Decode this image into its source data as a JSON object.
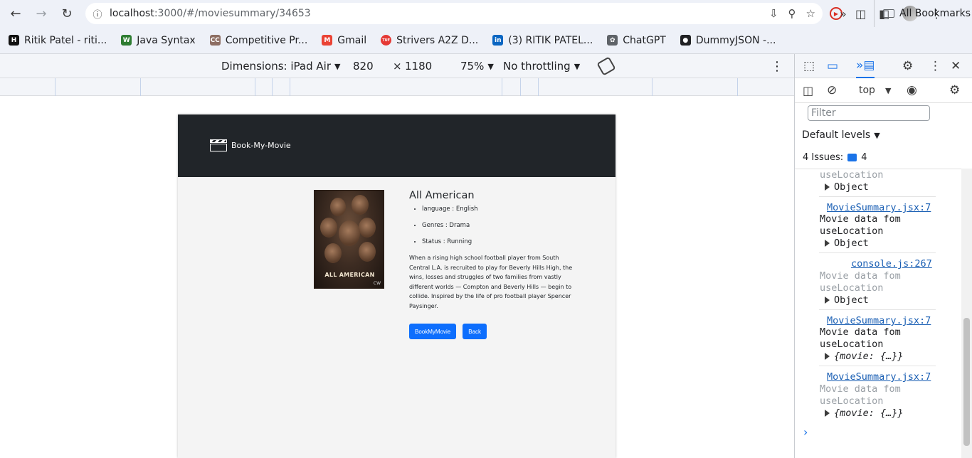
{
  "browser": {
    "url_host": "localhost",
    "url_path": ":3000/#/moviesummary/34653"
  },
  "bookmarks": [
    {
      "label": "Ritik Patel - riti...",
      "color": "#111111",
      "glyph": "H"
    },
    {
      "label": "Java Syntax",
      "color": "#2e7d32",
      "glyph": "W"
    },
    {
      "label": "Competitive Pr...",
      "color": "#8d6e63",
      "glyph": "CC"
    },
    {
      "label": "Gmail",
      "color": "#ea4335",
      "glyph": "M"
    },
    {
      "label": "Strivers A2Z D...",
      "color": "#e53935",
      "glyph": "TUF"
    },
    {
      "label": "(3) RITIK PATEL...",
      "color": "#0a66c2",
      "glyph": "in"
    },
    {
      "label": "ChatGPT",
      "color": "#5f6368",
      "glyph": "✿"
    },
    {
      "label": "DummyJSON -...",
      "color": "#202124",
      "glyph": "●"
    }
  ],
  "bookmarks_all": "All Bookmarks",
  "device_toolbar": {
    "dimensions": "Dimensions: iPad Air",
    "width": "820",
    "times": "×",
    "height": "1180",
    "zoom": "75%",
    "throttle": "No throttling"
  },
  "app": {
    "brand": "Book-My-Movie",
    "movie": {
      "title": "All American",
      "poster_title": "ALL AMERICAN",
      "poster_network": "CW",
      "details": [
        "language : English",
        "Genres : Drama",
        "Status : Running"
      ],
      "summary": "When a rising high school football player from South Central L.A. is recruited to play for Beverly Hills High, the wins, losses and struggles of two families from vastly different worlds — Compton and Beverly Hills — begin to collide. Inspired by the life of pro football player Spencer Paysinger."
    },
    "buttons": {
      "book": "BookMyMovie",
      "back": "Back"
    }
  },
  "devtools": {
    "context": "top",
    "filter_placeholder": "Filter",
    "levels": "Default levels",
    "issues_label": "4 Issues:",
    "issues_count": "4",
    "console": {
      "l1": "useLocation",
      "l2": "Object",
      "src1": "MovieSummary.jsx:7",
      "msg1a": "Movie data fom",
      "msg1b": "useLocation",
      "obj1": "Object",
      "src2": "console.js:267",
      "msg2a": "Movie data fom",
      "msg2b": "useLocation",
      "obj2": "Object",
      "src3": "MovieSummary.jsx:7",
      "msg3a": "Movie data fom",
      "msg3b": "useLocation",
      "obj3": "{movie: {…}}",
      "src4": "MovieSummary.jsx:7",
      "msg4a": "Movie data fom",
      "msg4b": "useLocation",
      "obj4": "{movie: {…}}"
    }
  }
}
